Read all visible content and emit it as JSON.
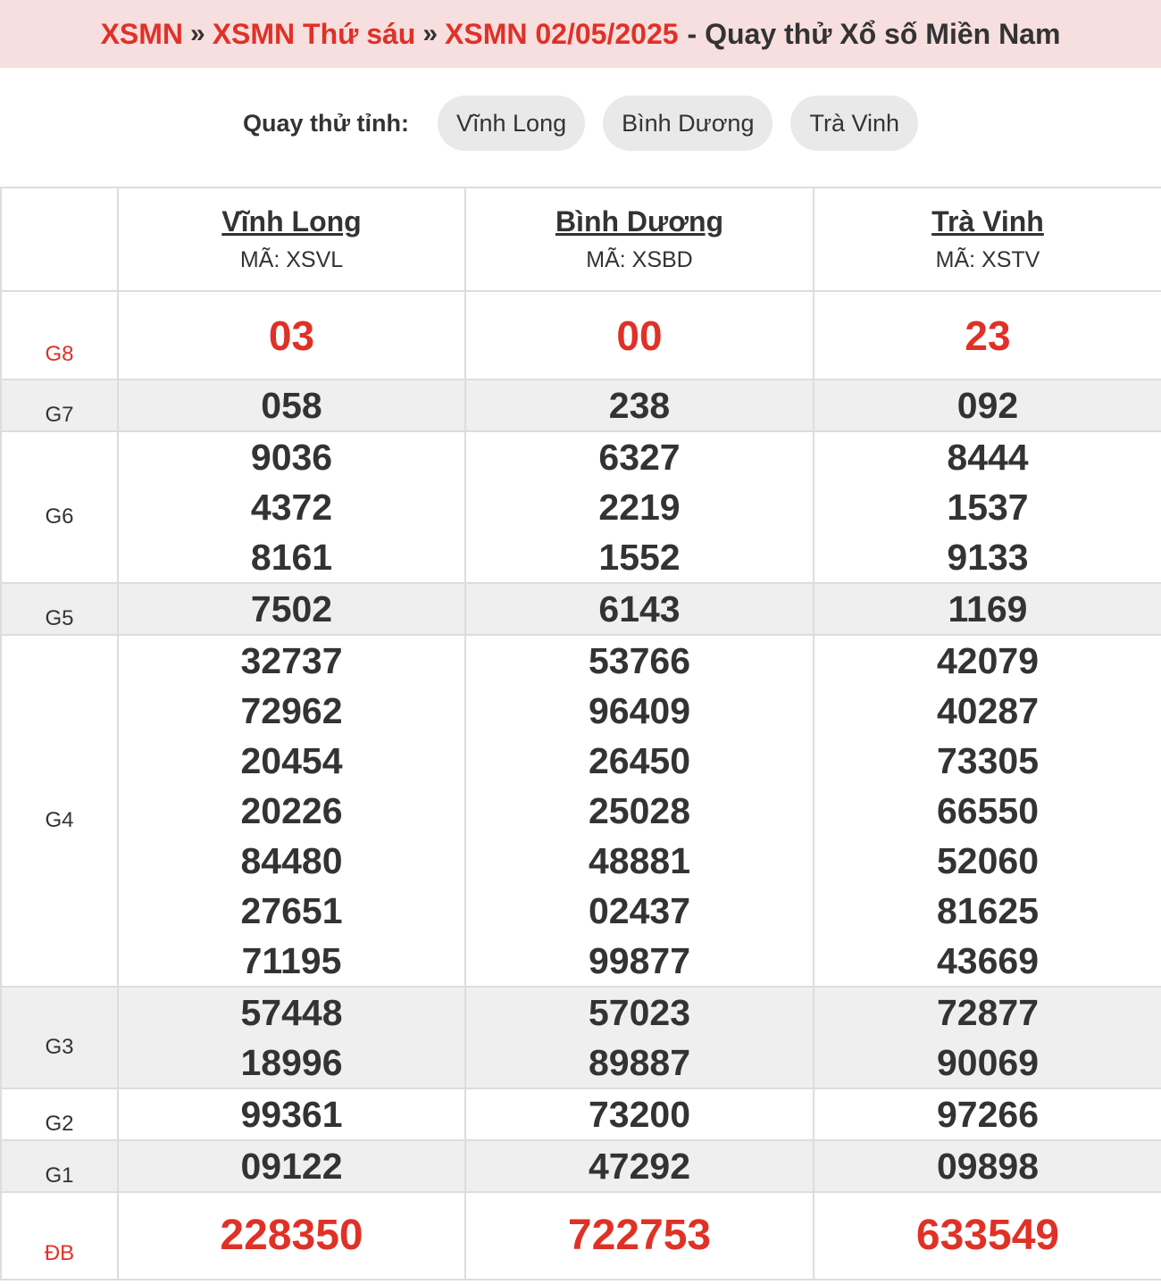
{
  "breadcrumb": {
    "item1": "XSMN",
    "item2": "XSMN Thứ sáu",
    "item3": "XSMN 02/05/2025",
    "separator": "»",
    "tail": "- Quay thử Xổ số Miền Nam"
  },
  "quay_thu": {
    "label": "Quay thử tỉnh:",
    "buttons": [
      "Vĩnh Long",
      "Bình Dương",
      "Trà Vinh"
    ]
  },
  "provinces": [
    {
      "name": "Vĩnh Long",
      "code": "MÃ: XSVL"
    },
    {
      "name": "Bình Dương",
      "code": "MÃ: XSBD"
    },
    {
      "name": "Trà Vinh",
      "code": "MÃ: XSTV"
    }
  ],
  "prizes": {
    "g8": {
      "label": "G8",
      "values": [
        [
          "03"
        ],
        [
          "00"
        ],
        [
          "23"
        ]
      ]
    },
    "g7": {
      "label": "G7",
      "values": [
        [
          "058"
        ],
        [
          "238"
        ],
        [
          "092"
        ]
      ]
    },
    "g6": {
      "label": "G6",
      "values": [
        [
          "9036",
          "4372",
          "8161"
        ],
        [
          "6327",
          "2219",
          "1552"
        ],
        [
          "8444",
          "1537",
          "9133"
        ]
      ]
    },
    "g5": {
      "label": "G5",
      "values": [
        [
          "7502"
        ],
        [
          "6143"
        ],
        [
          "1169"
        ]
      ]
    },
    "g4": {
      "label": "G4",
      "values": [
        [
          "32737",
          "72962",
          "20454",
          "20226",
          "84480",
          "27651",
          "71195"
        ],
        [
          "53766",
          "96409",
          "26450",
          "25028",
          "48881",
          "02437",
          "99877"
        ],
        [
          "42079",
          "40287",
          "73305",
          "66550",
          "52060",
          "81625",
          "43669"
        ]
      ]
    },
    "g3": {
      "label": "G3",
      "values": [
        [
          "57448",
          "18996"
        ],
        [
          "57023",
          "89887"
        ],
        [
          "72877",
          "90069"
        ]
      ]
    },
    "g2": {
      "label": "G2",
      "values": [
        [
          "99361"
        ],
        [
          "73200"
        ],
        [
          "97266"
        ]
      ]
    },
    "g1": {
      "label": "G1",
      "values": [
        [
          "09122"
        ],
        [
          "47292"
        ],
        [
          "09898"
        ]
      ]
    },
    "db": {
      "label": "ĐB",
      "values": [
        [
          "228350"
        ],
        [
          "722753"
        ],
        [
          "633549"
        ]
      ]
    }
  },
  "colors": {
    "accent_red": "#e03127",
    "title_bg": "#f7dedf",
    "row_gray": "#efefef",
    "pill_bg": "#e9e9e9"
  }
}
